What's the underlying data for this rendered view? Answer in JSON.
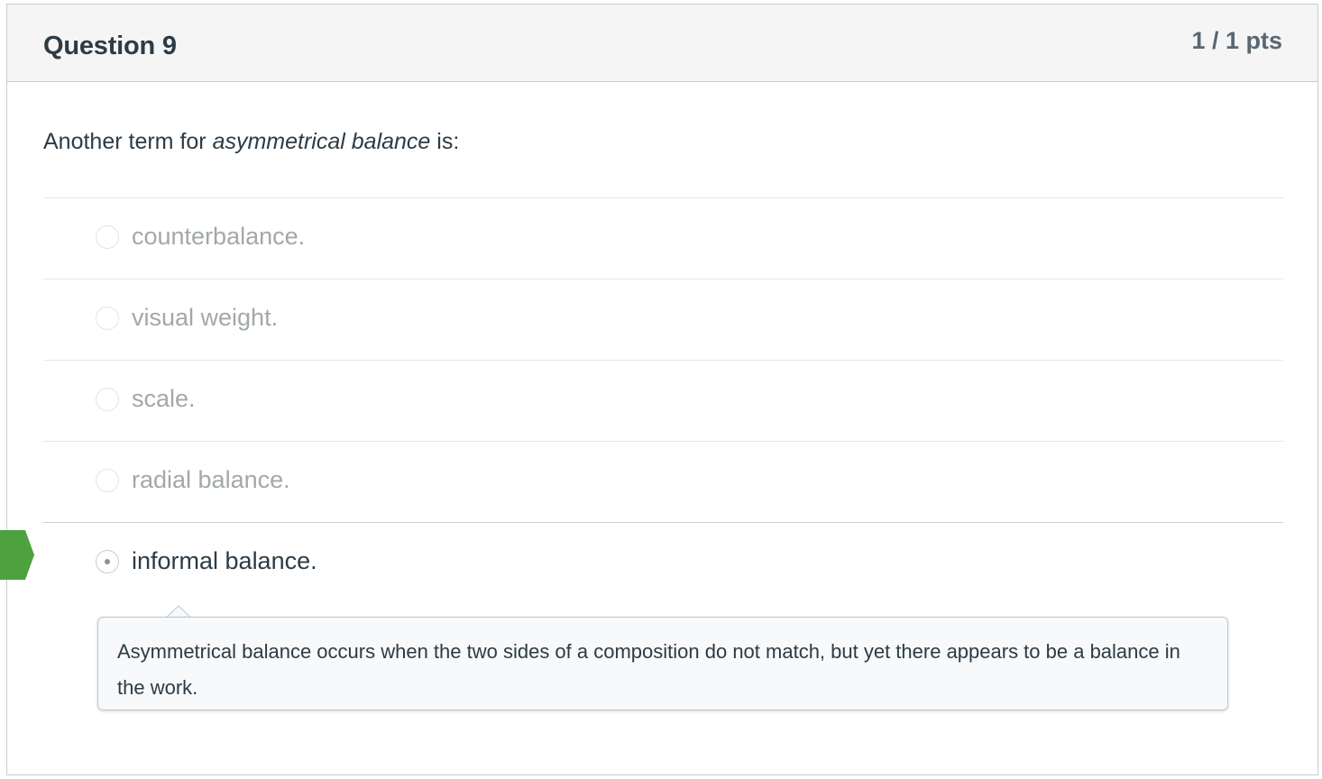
{
  "question": {
    "title": "Question 9",
    "points": "1 / 1 pts",
    "text_before": "Another term for ",
    "text_emphasis": "asymmetrical balance",
    "text_after": " is:"
  },
  "answers": [
    {
      "label": "counterbalance.",
      "selected": false
    },
    {
      "label": "visual weight.",
      "selected": false
    },
    {
      "label": "scale.",
      "selected": false
    },
    {
      "label": "radial balance.",
      "selected": false
    },
    {
      "label": "informal balance.",
      "selected": true
    }
  ],
  "comment": {
    "text": "Asymmetrical balance occurs when the two sides of a composition do not match, but yet there appears to be a balance in the work."
  },
  "colors": {
    "correct_marker": "#4da13e",
    "header_bg": "#f5f5f5",
    "border": "#c7cdd1",
    "text": "#2d3b45",
    "muted_text": "#a2a8ac"
  },
  "icons": {
    "correct_answer_marker": "correct-arrow-icon",
    "selected_radio": "radio-selected-icon"
  }
}
